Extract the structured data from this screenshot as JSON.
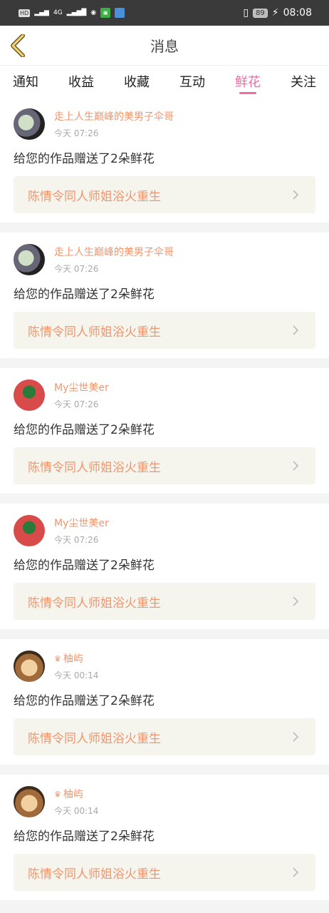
{
  "status_bar": {
    "left_label": "HD",
    "network": "4G",
    "time": "08:08",
    "battery": "89"
  },
  "header": {
    "title": "消息"
  },
  "tabs": [
    {
      "label": "通知",
      "active": false
    },
    {
      "label": "收益",
      "active": false
    },
    {
      "label": "收藏",
      "active": false
    },
    {
      "label": "互动",
      "active": false
    },
    {
      "label": "鲜花",
      "active": true
    },
    {
      "label": "关注",
      "active": false
    }
  ],
  "messages": [
    {
      "name": "走上人生巅峰的美男子伞哥",
      "time": "今天 07:26",
      "text": "给您的作品赠送了2朵鲜花",
      "work": "陈情令同人师姐浴火重生",
      "vip": false
    },
    {
      "name": "走上人生巅峰的美男子伞哥",
      "time": "今天 07:26",
      "text": "给您的作品赠送了2朵鲜花",
      "work": "陈情令同人师姐浴火重生",
      "vip": false
    },
    {
      "name": "My尘世美er",
      "time": "今天 07:26",
      "text": "给您的作品赠送了2朵鲜花",
      "work": "陈情令同人师姐浴火重生",
      "vip": false
    },
    {
      "name": "My尘世美er",
      "time": "今天 07:26",
      "text": "给您的作品赠送了2朵鲜花",
      "work": "陈情令同人师姐浴火重生",
      "vip": false
    },
    {
      "name": "柚屿",
      "time": "今天 00:14",
      "text": "给您的作品赠送了2朵鲜花",
      "work": "陈情令同人师姐浴火重生",
      "vip": true
    },
    {
      "name": "柚屿",
      "time": "今天 00:14",
      "text": "给您的作品赠送了2朵鲜花",
      "work": "陈情令同人师姐浴火重生",
      "vip": true
    }
  ],
  "icons": {
    "back": "back-chevron-icon",
    "row_arrow": "chevron-right-icon",
    "vip": "crown-icon"
  },
  "colors": {
    "accent": "#ee6aa7",
    "name": "#f0956d",
    "card_bg": "#f5f5ee"
  }
}
